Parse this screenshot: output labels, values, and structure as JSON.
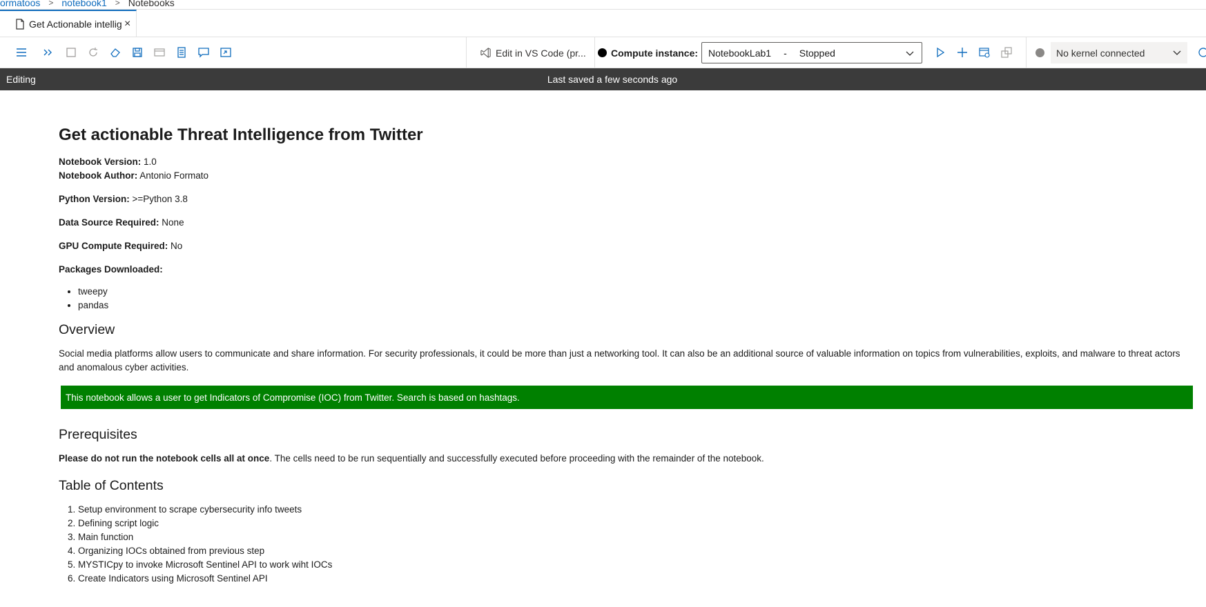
{
  "breadcrumb": {
    "items": [
      "ormatoos",
      "notebook1"
    ],
    "current": "Notebooks"
  },
  "tab": {
    "label": "Get Actionable intellig",
    "close": "×"
  },
  "toolbar": {
    "icons": [
      "menu-icon",
      "run-all-icon",
      "stop-icon",
      "restart-icon",
      "clear-outputs-icon",
      "save-icon",
      "variable-explorer-icon",
      "outline-icon",
      "comments-icon",
      "open-terminal-icon"
    ],
    "vscode_label": "Edit in VS Code (pr...",
    "compute_label": "Compute instance:",
    "compute_name": "NotebookLab1",
    "compute_dash": "-",
    "compute_status": "Stopped",
    "kernel_label": "No kernel connected"
  },
  "status": {
    "mode": "Editing",
    "saved": "Last saved a few seconds ago"
  },
  "notebook": {
    "title": "Get actionable Threat Intelligence from Twitter",
    "version_label": "Notebook Version:",
    "version_value": " 1.0",
    "author_label": "Notebook Author:",
    "author_value": " Antonio Formato",
    "python_label": "Python Version:",
    "python_value": " >=Python 3.8",
    "datasource_label": "Data Source Required:",
    "datasource_value": " None",
    "gpu_label": "GPU Compute Required:",
    "gpu_value": " No",
    "packages_label": "Packages Downloaded:",
    "packages": [
      "tweepy",
      "pandas"
    ],
    "overview_heading": "Overview",
    "overview_text": "Social media platforms allow users to communicate and share information. For security professionals, it could be more than just a networking tool. It can also be an additional source of valuable information on topics from vulnerabilities, exploits, and malware to threat actors and anomalous cyber activities.",
    "callout_text": "This notebook allows a user to get Indicators of Compromise (IOC) from Twitter. Search is based on hashtags.",
    "callout_color": "#008000",
    "prereq_heading": "Prerequisites",
    "prereq_bold": "Please do not run the notebook cells all at once",
    "prereq_text": ". The cells need to be run sequentially and successfully executed before proceeding with the remainder of the notebook.",
    "toc_heading": "Table of Contents",
    "toc": [
      "Setup environment to scrape cybersecurity info tweets",
      "Defining script logic",
      "Main function",
      "Organizing IOCs obtained from previous step",
      "MYSTICpy to invoke Microsoft Sentinel API to work wiht IOCs",
      "Create Indicators using Microsoft Sentinel API"
    ]
  },
  "colors": {
    "accent": "#0f6cbd",
    "statusbar": "#3b3b3b",
    "callout": "#008000"
  }
}
